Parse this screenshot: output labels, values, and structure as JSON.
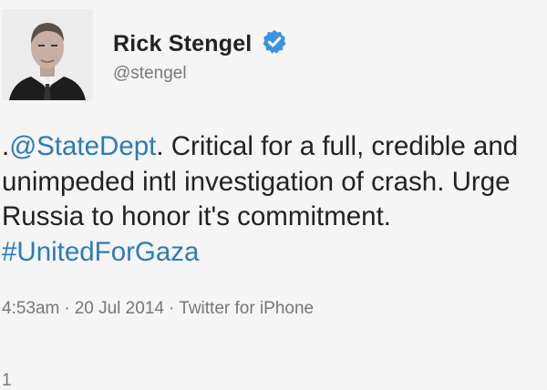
{
  "author": {
    "name": "Rick Stengel",
    "handle": "@stengel",
    "verified_icon": "verified-badge-icon",
    "verified_color": "#3a92e3"
  },
  "tweet": {
    "prefix": ".",
    "mention": "@StateDept",
    "text_line1_rest": ". Critical for a full, credible and",
    "text_line2": "unimpeded intl investigation of crash. Urge",
    "text_line3": "Russia to honor it's commitment.",
    "hashtag": "#UnitedForGaza",
    "link_color": "#2b7bb9"
  },
  "meta": {
    "time": "4:53am",
    "date": "20 Jul 2014",
    "source": "Twitter for iPhone",
    "separator": "·"
  },
  "footer": {
    "cut_text": "1"
  }
}
